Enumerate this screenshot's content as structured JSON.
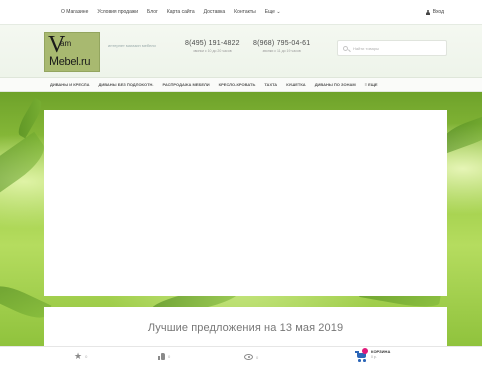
{
  "topnav": {
    "items": [
      "О Магазине",
      "Условия продажи",
      "Блог",
      "Карта сайта",
      "Доставка",
      "Контакты",
      "Еще"
    ],
    "login": "Вход"
  },
  "header": {
    "logo": {
      "mark": "V",
      "top": "am",
      "bottom": "ebel.ru",
      "alt": "VamMebel.ru"
    },
    "slogan": "интернет магазин мебели",
    "phones": [
      {
        "number": "8(495) 191-4822",
        "hours": "звонки с 10 до 20 часов"
      },
      {
        "number": "8(968) 795-04-61",
        "hours": "звонки с 11 до 19 часов"
      }
    ],
    "search_placeholder": "Найти товары"
  },
  "categories": [
    "ДИВАНЫ И КРЕСЛА",
    "ДИВАНЫ БЕЗ ПОДЛОКОТН.",
    "РАСПРОДАЖА МЕБЕЛИ",
    "КРЕСЛО-КРОВАТЬ",
    "ТАХТА",
    "КУШЕТКА",
    "ДИВАНЫ ПО ЗОНАМ",
    "ЕЩЕ"
  ],
  "main": {
    "offers_title": "Лучшие предложения на 13 мая 2019"
  },
  "bottombar": {
    "favorites_count": "0",
    "compare_count": "0",
    "viewed_count": "0",
    "cart_label": "КОРЗИНА",
    "cart_sum": "0 р."
  },
  "colors": {
    "accent_green": "#9ccc45",
    "logo_bg": "#a8b970",
    "cart_blue": "#2c66b8",
    "cart_badge": "#e0197a"
  }
}
